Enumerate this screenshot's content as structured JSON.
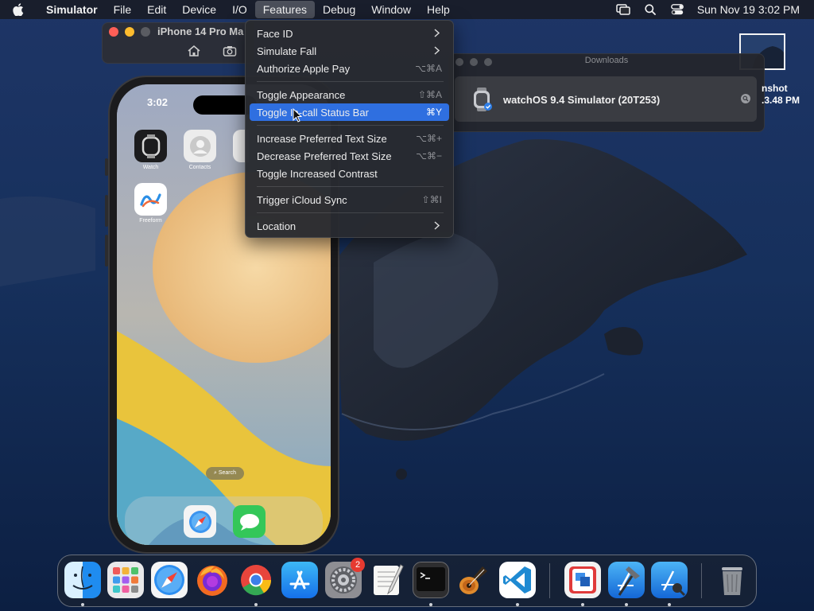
{
  "menubar": {
    "app_name": "Simulator",
    "menus": [
      "File",
      "Edit",
      "Device",
      "I/O",
      "Features",
      "Debug",
      "Window",
      "Help"
    ],
    "active_menu": "Features",
    "clock": "Sun Nov 19  3:02 PM"
  },
  "simulator_window": {
    "title": "iPhone 14 Pro Ma"
  },
  "iphone": {
    "time": "3:02",
    "apps": [
      {
        "label": "Watch"
      },
      {
        "label": "Contacts"
      },
      {
        "label": "Freeform"
      }
    ],
    "search_label": "Search"
  },
  "features_menu": {
    "items": [
      {
        "label": "Face ID",
        "shortcut": "",
        "submenu": true
      },
      {
        "label": "Simulate Fall",
        "shortcut": "",
        "submenu": true
      },
      {
        "label": "Authorize Apple Pay",
        "shortcut": "⌥⌘A",
        "submenu": false
      },
      {
        "label": "Toggle Appearance",
        "shortcut": "⇧⌘A",
        "submenu": false
      },
      {
        "label": "Toggle In-call Status Bar",
        "shortcut": "⌘Y",
        "submenu": false,
        "highlighted": true
      },
      {
        "label": "Increase Preferred Text Size",
        "shortcut": "⌥⌘+",
        "submenu": false
      },
      {
        "label": "Decrease Preferred Text Size",
        "shortcut": "⌥⌘−",
        "submenu": false
      },
      {
        "label": "Toggle Increased Contrast",
        "shortcut": "",
        "submenu": false
      },
      {
        "label": "Trigger iCloud Sync",
        "shortcut": "⇧⌘I",
        "submenu": false
      },
      {
        "label": "Location",
        "shortcut": "",
        "submenu": true
      }
    ]
  },
  "downloads_window": {
    "title": "Downloads",
    "item_name": "watchOS 9.4 Simulator (20T253)"
  },
  "desktop": {
    "icon_label_line1": "nshot",
    "icon_label_line2": ".3.48 PM"
  },
  "dock": {
    "apps": [
      "Finder",
      "Launchpad",
      "Safari",
      "Firefox",
      "Chrome",
      "App Store",
      "System Settings",
      "TextEdit",
      "Terminal",
      "GarageBand",
      "Visual Studio Code",
      "Simulator",
      "Xcode",
      "Instruments",
      "Trash"
    ],
    "settings_badge": "2"
  },
  "colors": {
    "menu_highlight": "#2f6fe0",
    "menu_bg": "#28292f"
  }
}
